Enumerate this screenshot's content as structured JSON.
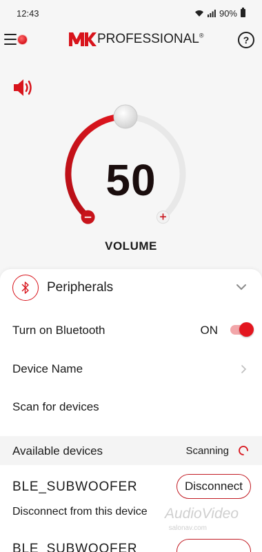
{
  "status_bar": {
    "time": "12:43",
    "battery": "90%"
  },
  "header": {
    "brand": "PROFESSIONAL",
    "brand_mark": "®",
    "help_label": "?"
  },
  "volume": {
    "value": "50",
    "label": "VOLUME",
    "level_fraction": 0.5,
    "minus": "−",
    "plus": "+"
  },
  "peripherals": {
    "title": "Peripherals",
    "bluetooth": {
      "label": "Turn on Bluetooth",
      "state": "ON",
      "enabled": true
    },
    "device_name_label": "Device Name",
    "scan_label": "Scan for devices",
    "available_label": "Available devices",
    "scanning_label": "Scanning",
    "devices": [
      {
        "name": "BLE_SUBWOOFER",
        "subtitle": "Disconnect from this device",
        "action": "Disconnect"
      },
      {
        "name": "BLE_SUBWOOFER",
        "subtitle": "",
        "action": ""
      }
    ]
  },
  "watermark": {
    "text": "AudioVideo",
    "sub": "salonav.com"
  },
  "colors": {
    "accent": "#d8141c",
    "track": "#e6e6e6",
    "background": "#f6f6f6"
  }
}
